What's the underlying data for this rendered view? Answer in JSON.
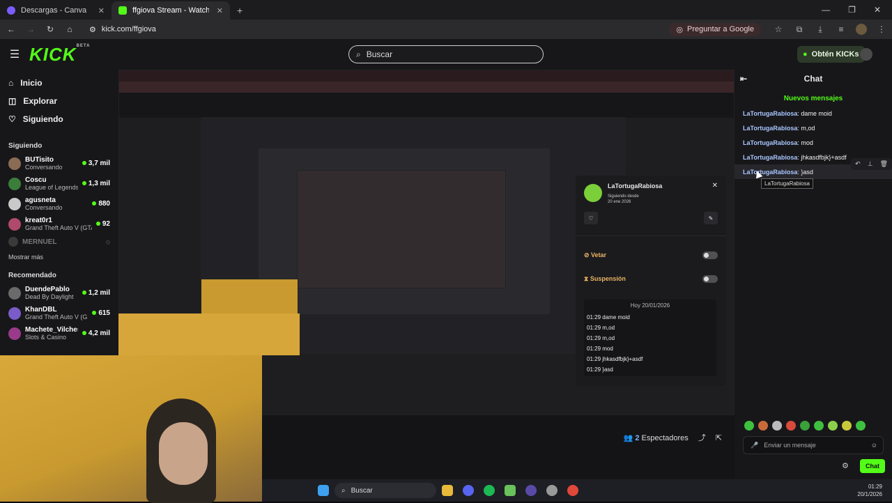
{
  "browser": {
    "tabs": [
      {
        "title": "Descargas - Canva",
        "favicon_color": "#7b5cff",
        "active": false
      },
      {
        "title": "ffgiova Stream - Watch Live on",
        "favicon_color": "#53fc18",
        "active": true
      }
    ],
    "url": "kick.com/ffgiova",
    "ask_google": "Preguntar a Google"
  },
  "header": {
    "logo": "KICK",
    "logo_badge": "BETA",
    "search_placeholder": "Buscar",
    "get_kicks": "Obtén KICKs"
  },
  "sidebar": {
    "nav": [
      {
        "label": "Inicio",
        "icon": "home-icon"
      },
      {
        "label": "Explorar",
        "icon": "compass-icon"
      },
      {
        "label": "Siguiendo",
        "icon": "heart-icon"
      }
    ],
    "following_title": "Siguiendo",
    "following": [
      {
        "name": "BUTisito",
        "category": "Conversando",
        "viewers": "3,7 mil",
        "avatar_color": "#8a6b54"
      },
      {
        "name": "Coscu",
        "category": "League of Legends",
        "viewers": "1,3 mil",
        "avatar_color": "#3b7d3b"
      },
      {
        "name": "agusneta",
        "category": "Conversando",
        "viewers": "880",
        "avatar_color": "#c9c9c9"
      },
      {
        "name": "kreat0r1",
        "category": "Grand Theft Auto V (GTA)",
        "viewers": "92",
        "avatar_color": "#b04a6a"
      }
    ],
    "offline": {
      "name": "MERNUEL"
    },
    "show_more": "Mostrar más",
    "recommended_title": "Recomendado",
    "recommended": [
      {
        "name": "DuendePablo",
        "category": "Dead By Daylight",
        "viewers": "1,2 mil",
        "avatar_color": "#6a6a6a"
      },
      {
        "name": "KhanDBL",
        "category": "Grand Theft Auto V (G...",
        "viewers": "615",
        "avatar_color": "#7a5cc8"
      },
      {
        "name": "Machete_Vilches",
        "category": "Slots & Casino",
        "viewers": "4,2 mil",
        "avatar_color": "#9a3a8a"
      }
    ]
  },
  "stream": {
    "spectators_count": "2",
    "spectators_label": "Espectadores"
  },
  "chat": {
    "title": "Chat",
    "new_messages": "Nuevos mensajes",
    "messages": [
      {
        "user": "LaTortugaRabiosa",
        "text": "dame moid"
      },
      {
        "user": "LaTortugaRabiosa",
        "text": "m,od"
      },
      {
        "user": "LaTortugaRabiosa",
        "text": "mod"
      },
      {
        "user": "LaTortugaRabiosa",
        "text": "jhkasdfbjk}+asdf"
      },
      {
        "user": "LaTortugaRabiosa",
        "text": "}asd"
      }
    ],
    "tooltip": "LaTortugaRabiosa",
    "input_placeholder": "Enviar un mensaje",
    "send_label": "Chat"
  },
  "user_card": {
    "name": "LaTortugaRabiosa",
    "following_since_label": "Siguiendo desde",
    "following_since_date": "20 ene 2026",
    "ban_label": "Vetar",
    "timeout_label": "Suspensión",
    "history_date": "Hoy 20/01/2026",
    "history": [
      {
        "time": "01:29",
        "text": "dame moid"
      },
      {
        "time": "01:29",
        "text": "m,od"
      },
      {
        "time": "01:29",
        "text": "m,od"
      },
      {
        "time": "01:29",
        "text": "mod"
      },
      {
        "time": "01:29",
        "text": "jhkasdfbjk}+asdf"
      },
      {
        "time": "01:29",
        "text": "}asd"
      }
    ]
  },
  "taskbar": {
    "search": "Buscar",
    "time": "01:29",
    "date": "20/1/2026"
  }
}
